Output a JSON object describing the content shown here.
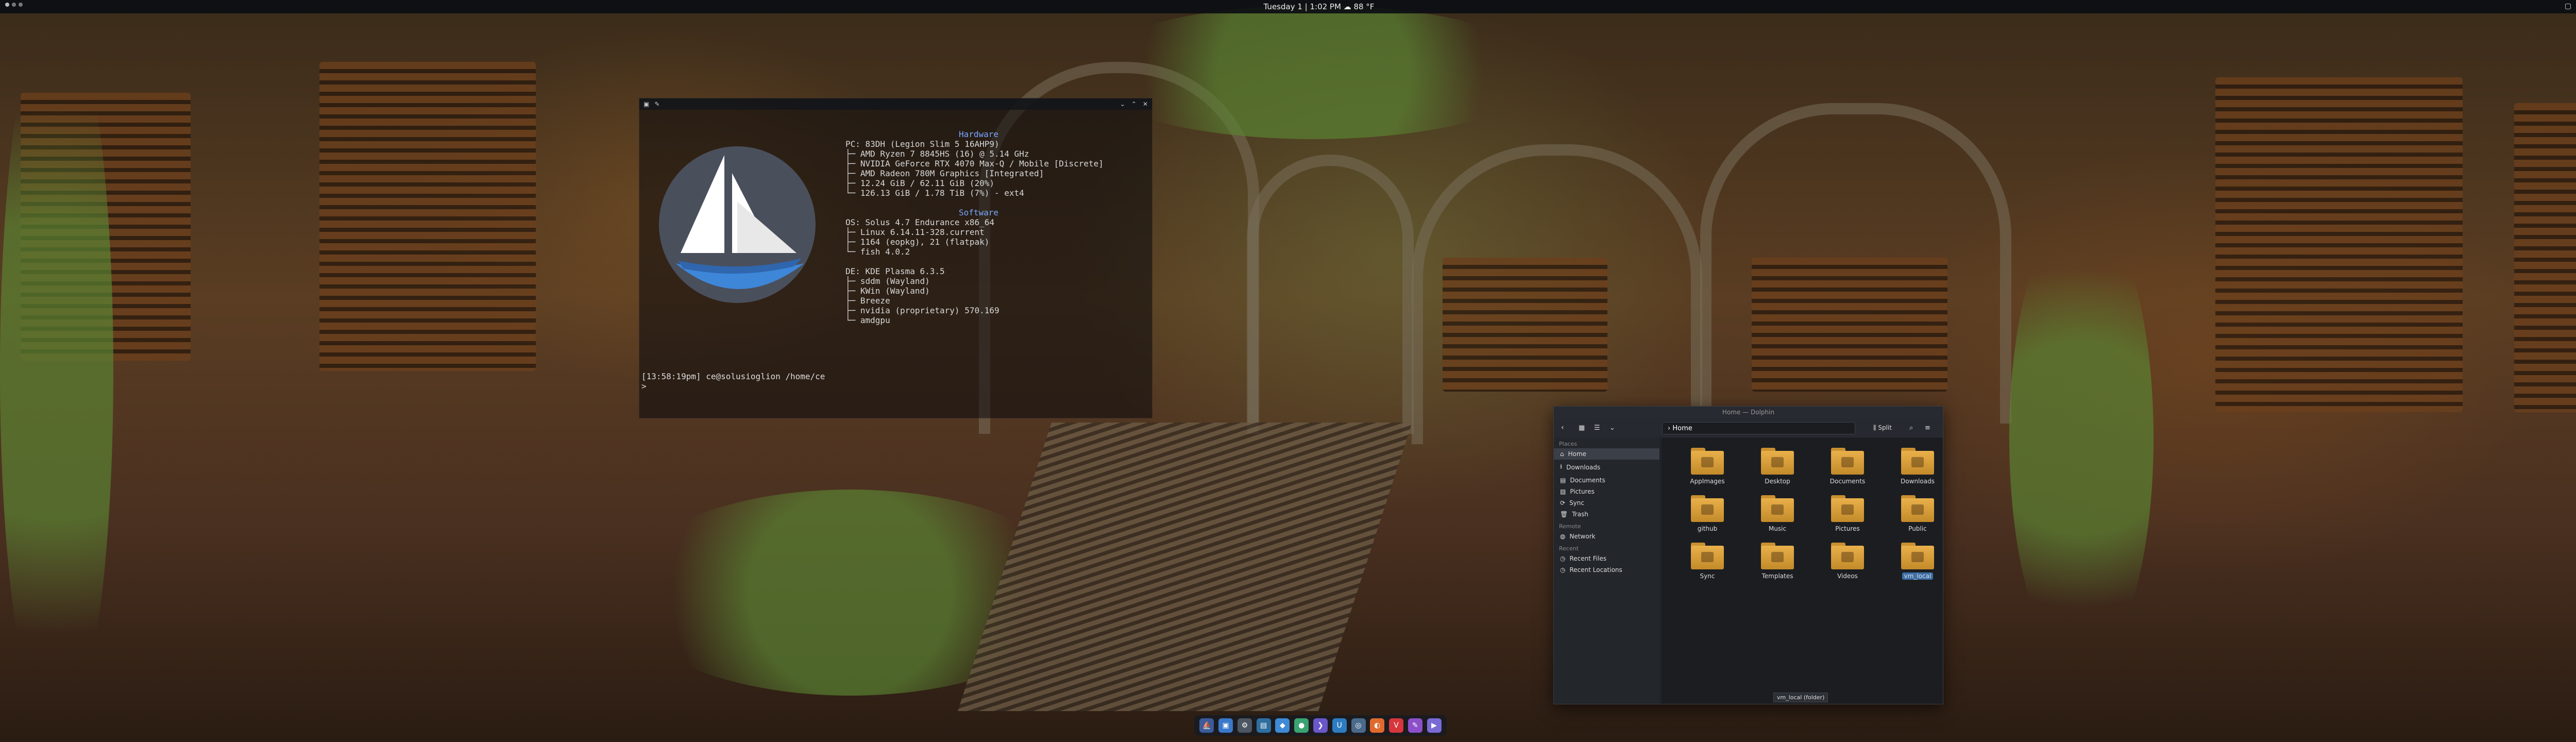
{
  "panel": {
    "clock": "Tuesday 1 | 1:02 PM ☁ 88 °F",
    "tray_icons": [
      "wallet-icon",
      "update-icon",
      "volume-icon",
      "bluetooth-icon",
      "network-icon",
      "battery-icon"
    ]
  },
  "terminal": {
    "prompt": "[13:58:19pm] ce@solusioglion /home/ce",
    "prompt_user": "ce@solusioglion",
    "prompt_path": "/home/ce",
    "prompt_line2": "> ",
    "hardware_header": "Hardware",
    "hardware": [
      "PC: 83DH (Legion Slim 5 16AHP9)",
      "├─ AMD Ryzen 7 8845HS (16) @ 5.14 GHz",
      "├─ NVIDIA GeForce RTX 4070 Max-Q / Mobile [Discrete]",
      "├─ AMD Radeon 780M Graphics [Integrated]",
      "├─ 12.24 GiB / 62.11 GiB (20%)",
      "└─ 126.13 GiB / 1.78 TiB (7%) - ext4"
    ],
    "software_header": "Software",
    "software": [
      "OS: Solus 4.7 Endurance x86_64",
      "├─ Linux 6.14.11-328.current",
      "├─ 1164 (eopkg), 21 (flatpak)",
      "└─ fish 4.0.2"
    ],
    "desktop": [
      "DE: KDE Plasma 6.3.5",
      "├─ sddm (Wayland)",
      "├─ KWin (Wayland)",
      "├─ Breeze",
      "├─ nvidia (proprietary) 570.169",
      "└─ amdgpu"
    ]
  },
  "file_manager": {
    "window_title": "Home — Dolphin",
    "breadcrumb": "Home",
    "split_label": "Split",
    "places_header": "Places",
    "places": [
      {
        "label": "Home",
        "icon": "home-icon",
        "active": true
      },
      {
        "label": "Downloads",
        "icon": "download-icon"
      },
      {
        "label": "Documents",
        "icon": "document-icon"
      },
      {
        "label": "Pictures",
        "icon": "pictures-icon"
      },
      {
        "label": "Sync",
        "icon": "sync-icon"
      },
      {
        "label": "Trash",
        "icon": "trash-icon"
      }
    ],
    "remote_header": "Remote",
    "remote": [
      {
        "label": "Network",
        "icon": "network-icon"
      }
    ],
    "recent_header": "Recent",
    "recent": [
      {
        "label": "Recent Files",
        "icon": "recent-files-icon"
      },
      {
        "label": "Recent Locations",
        "icon": "recent-locations-icon"
      }
    ],
    "folders": [
      {
        "label": "AppImages"
      },
      {
        "label": "Desktop"
      },
      {
        "label": "Documents"
      },
      {
        "label": "Downloads"
      },
      {
        "label": "github"
      },
      {
        "label": "Music"
      },
      {
        "label": "Pictures"
      },
      {
        "label": "Public"
      },
      {
        "label": "Sync"
      },
      {
        "label": "Templates"
      },
      {
        "label": "Videos"
      },
      {
        "label": "vm_local",
        "selected": true
      }
    ],
    "status": "vm_local (folder)"
  },
  "dock": {
    "apps": [
      {
        "name": "solus-menu-icon",
        "color": "#3b5b9a",
        "glyph": "⛵"
      },
      {
        "name": "files-icon",
        "color": "#3a78c9",
        "glyph": "▣"
      },
      {
        "name": "settings-icon",
        "color": "#4c5562",
        "glyph": "⚙"
      },
      {
        "name": "monitor-icon",
        "color": "#2f6fa0",
        "glyph": "▤"
      },
      {
        "name": "discover-icon",
        "color": "#3f8ad6",
        "glyph": "◆"
      },
      {
        "name": "chat-icon",
        "color": "#3aa371",
        "glyph": "●"
      },
      {
        "name": "terminal-icon",
        "color": "#6a57c9",
        "glyph": "❯"
      },
      {
        "name": "editor-icon",
        "color": "#2d7cc2",
        "glyph": "U"
      },
      {
        "name": "git-icon",
        "color": "#4a6a8c",
        "glyph": "◎"
      },
      {
        "name": "firefox-icon",
        "color": "#e06a2e",
        "glyph": "◐"
      },
      {
        "name": "vivaldi-icon",
        "color": "#d6363c",
        "glyph": "V"
      },
      {
        "name": "notes-icon",
        "color": "#8c4fc9",
        "glyph": "✎"
      },
      {
        "name": "media-icon",
        "color": "#7a6ad6",
        "glyph": "▶"
      }
    ]
  }
}
